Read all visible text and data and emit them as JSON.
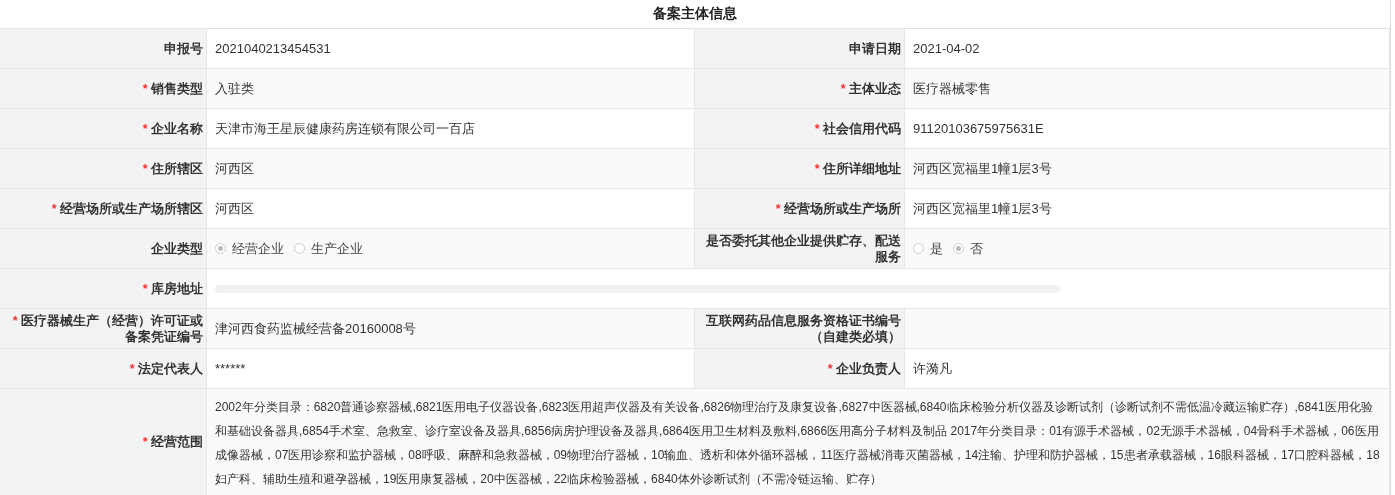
{
  "title": "备案主体信息",
  "rows": [
    {
      "fields": [
        {
          "label": "申报号",
          "kind": "text",
          "value": "2021040213454531"
        },
        {
          "label": "申请日期",
          "kind": "text",
          "value": "2021-04-02"
        }
      ]
    },
    {
      "fields": [
        {
          "mark": "*",
          "label": "销售类型",
          "kind": "text",
          "value": "入驻类"
        },
        {
          "mark": "*",
          "label": "主体业态",
          "kind": "text",
          "value": "医疗器械零售"
        }
      ]
    },
    {
      "fields": [
        {
          "mark": "*",
          "label": "企业名称",
          "kind": "text",
          "value": "天津市海王星辰健康药房连锁有限公司一百店"
        },
        {
          "mark": "*",
          "label": "社会信用代码",
          "kind": "text",
          "value": "91120103675975631E"
        }
      ]
    },
    {
      "fields": [
        {
          "mark": "*",
          "label": "住所辖区",
          "kind": "text",
          "value": "河西区"
        },
        {
          "mark": "*",
          "label": "住所详细地址",
          "kind": "text",
          "value": "河西区宽福里1幢1层3号"
        }
      ]
    },
    {
      "fields": [
        {
          "mark": "*",
          "label": "经营场所或生产场所辖区",
          "kind": "text",
          "value": "河西区"
        },
        {
          "mark": "*",
          "label": "经营场所或生产场所",
          "kind": "text",
          "value": "河西区宽福里1幢1层3号"
        }
      ]
    },
    {
      "fields": [
        {
          "label": "企业类型",
          "kind": "radio",
          "options": [
            {
              "label": "经营企业",
              "selected": true
            },
            {
              "label": "生产企业",
              "selected": false
            }
          ]
        },
        {
          "label": "是否委托其他企业提供贮存、配送服务",
          "kind": "radio",
          "options": [
            {
              "label": "是",
              "selected": false
            },
            {
              "label": "否",
              "selected": true
            }
          ]
        }
      ]
    },
    {
      "fields": [
        {
          "mark": "*",
          "label": "库房地址",
          "kind": "empty_field"
        }
      ]
    },
    {
      "fields": [
        {
          "mark": "*",
          "label": "医疗器械生产（经营）许可证或备案凭证编号",
          "kind": "text",
          "value": "津河西食药监械经营备20160008号"
        },
        {
          "label": "互联网药品信息服务资格证书编号（自建类必填）",
          "kind": "text"
        }
      ]
    },
    {
      "fields": [
        {
          "mark": "*",
          "label": "法定代表人",
          "kind": "text",
          "value": "******"
        },
        {
          "mark": "*",
          "label": "企业负责人",
          "kind": "text",
          "value": "许漪凡"
        }
      ]
    },
    {
      "fields": [
        {
          "mark": "*",
          "label": "经营范围",
          "kind": "paragraph",
          "value": "2002年分类目录：6820普通诊察器械,6821医用电子仪器设备,6823医用超声仪器及有关设备,6826物理治疗及康复设备,6827中医器械,6840临床检验分析仪器及诊断试剂（诊断试剂不需低温冷藏运输贮存）,6841医用化验和基础设备器具,6854手术室、急救室、诊疗室设备及器具,6856病房护理设备及器具,6864医用卫生材料及敷料,6866医用高分子材料及制品 2017年分类目录：01有源手术器械，02无源手术器械，04骨科手术器械，06医用成像器械，07医用诊察和监护器械，08呼吸、麻醉和急救器械，09物理治疗器械，10输血、透析和体外循环器械，11医疗器械消毒灭菌器械，14注输、护理和防护器械，15患者承载器械，16眼科器械，17口腔科器械，18妇产科、辅助生殖和避孕器械，19医用康复器械，20中医器械，22临床检验器械，6840体外诊断试剂（不需冷链运输、贮存）"
        }
      ]
    }
  ]
}
